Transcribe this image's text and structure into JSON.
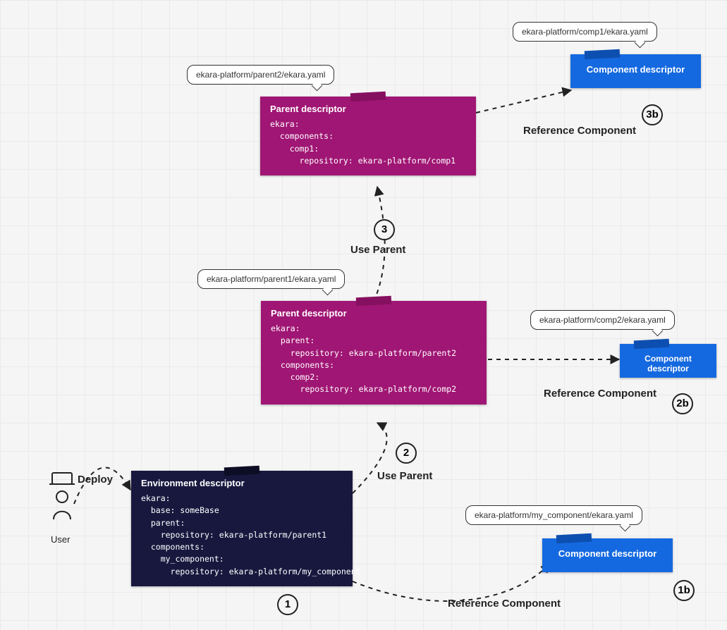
{
  "files": {
    "parent2": "ekara-platform/parent2/ekara.yaml",
    "parent1": "ekara-platform/parent1/ekara.yaml",
    "comp1": "ekara-platform/comp1/ekara.yaml",
    "comp2": "ekara-platform/comp2/ekara.yaml",
    "mycomp": "ekara-platform/my_component/ekara.yaml"
  },
  "cards": {
    "parent2": {
      "title": "Parent descriptor",
      "code": "ekara:\n  components:\n    comp1:\n      repository: ekara-platform/comp1"
    },
    "parent1": {
      "title": "Parent descriptor",
      "code": "ekara:\n  parent:\n    repository: ekara-platform/parent2\n  components:\n    comp2:\n      repository: ekara-platform/comp2"
    },
    "env": {
      "title": "Environment descriptor",
      "code": "ekara:\n  base: someBase\n  parent:\n    repository: ekara-platform/parent1\n  components:\n    my_component:\n      repository: ekara-platform/my_component"
    },
    "comp": {
      "title": "Component descriptor"
    }
  },
  "relations": {
    "use_parent": "Use Parent",
    "ref_comp": "Reference Component",
    "deploy": "Deploy"
  },
  "user_label": "User",
  "steps": {
    "s1": "1",
    "s2": "2",
    "s3": "3",
    "s1b": "1b",
    "s2b": "2b",
    "s3b": "3b"
  }
}
